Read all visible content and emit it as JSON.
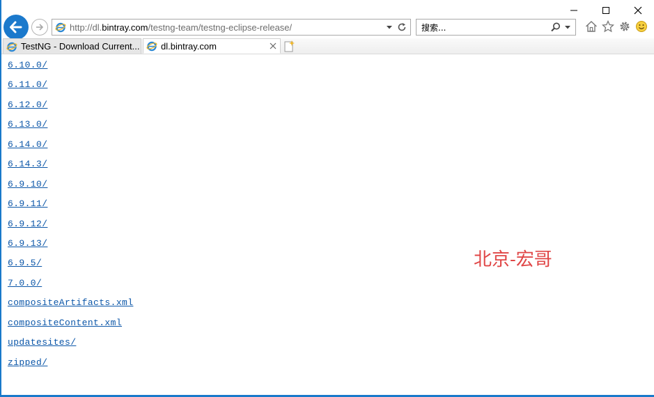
{
  "browser": {
    "address": {
      "prefix": "http://dl.",
      "domain": "bintray.com",
      "path": "/testng-team/testng-eclipse-release/"
    },
    "search_placeholder": "搜索...",
    "tabs": [
      {
        "label": "TestNG - Download Current..."
      },
      {
        "label": "dl.bintray.com"
      }
    ]
  },
  "listing": [
    "6.10.0/",
    "6.11.0/",
    "6.12.0/",
    "6.13.0/",
    "6.14.0/",
    "6.14.3/",
    "6.9.10/",
    "6.9.11/",
    "6.9.12/",
    "6.9.13/",
    "6.9.5/",
    "7.0.0/",
    "compositeArtifacts.xml",
    "compositeContent.xml",
    "updatesites/",
    "zipped/"
  ],
  "watermark": "北京-宏哥",
  "colors": {
    "accent": "#1b79cc",
    "link": "#0b56a8",
    "watermark": "#e04646"
  }
}
